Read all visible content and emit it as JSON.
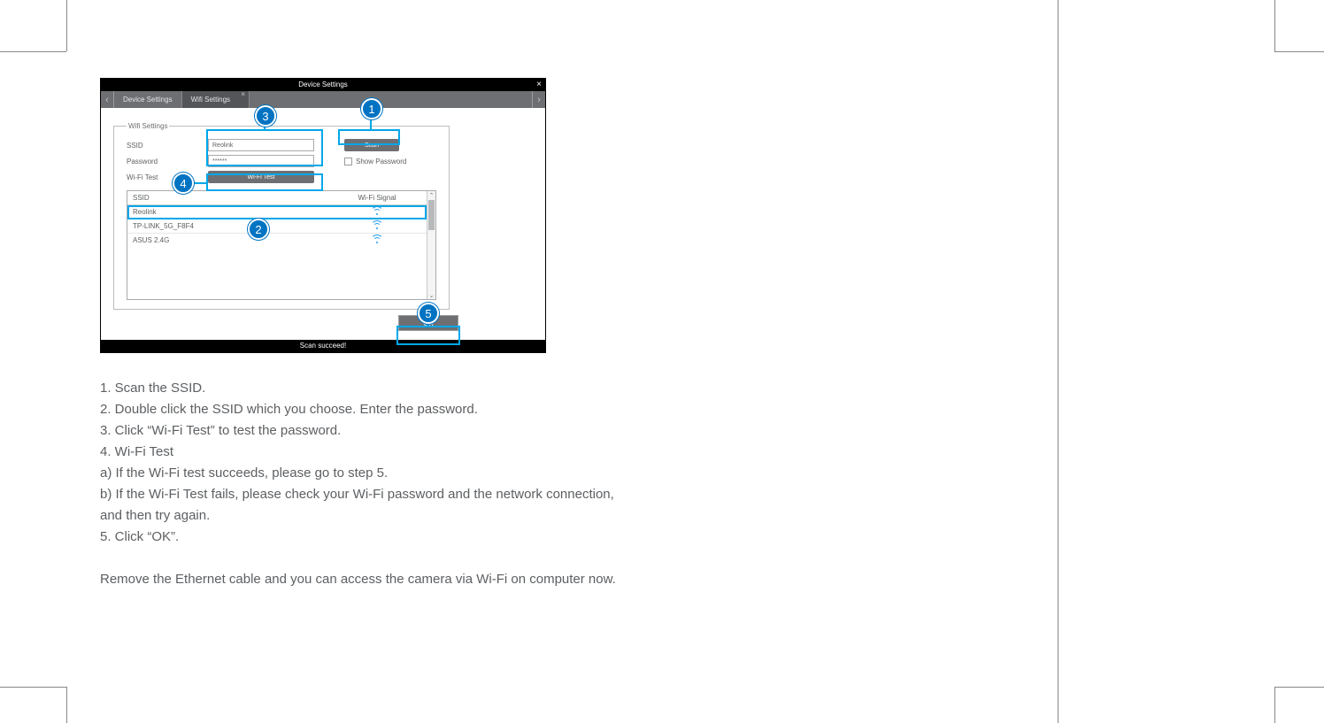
{
  "window": {
    "title": "Device Settings",
    "close": "×",
    "tabs": {
      "nav_prev": "‹",
      "nav_next": "›",
      "t0": "Device Settings",
      "t1": "Wifi Settings",
      "t1_close": "×"
    },
    "fieldset_legend": "Wifi Settings",
    "row_ssid": {
      "label": "SSID",
      "value": "Reolink",
      "scan_btn": "Scan"
    },
    "row_pwd": {
      "label": "Password",
      "value": "******",
      "show_label": "Show Password"
    },
    "row_test": {
      "label": "Wi-Fi Test",
      "btn": "Wi-Fi Test"
    },
    "table": {
      "head_ssid": "SSID",
      "head_signal": "Wi-Fi Signal",
      "rows": [
        {
          "ssid": "Reolink"
        },
        {
          "ssid": "TP-LINK_5G_F8F4"
        },
        {
          "ssid": "ASUS 2.4G"
        }
      ]
    },
    "ok": "OK",
    "status": "Scan succeed!"
  },
  "callouts": {
    "c1": "1",
    "c2": "2",
    "c3": "3",
    "c4": "4",
    "c5": "5"
  },
  "instructions": {
    "l1": "1. Scan the SSID.",
    "l2": "2. Double click the SSID which you choose. Enter the password.",
    "l3": "3. Click “Wi-Fi Test” to test the password.",
    "l4": "4. Wi-Fi Test",
    "l5": "a) If the Wi-Fi test succeeds, please go to step 5.",
    "l6": "b) If the Wi-Fi Test fails, please check your Wi-Fi password and the network connection,",
    "l7": "and then try again.",
    "l8": "5. Click “OK”.",
    "l9": "Remove the Ethernet cable and you can access the camera via Wi-Fi on computer now."
  }
}
